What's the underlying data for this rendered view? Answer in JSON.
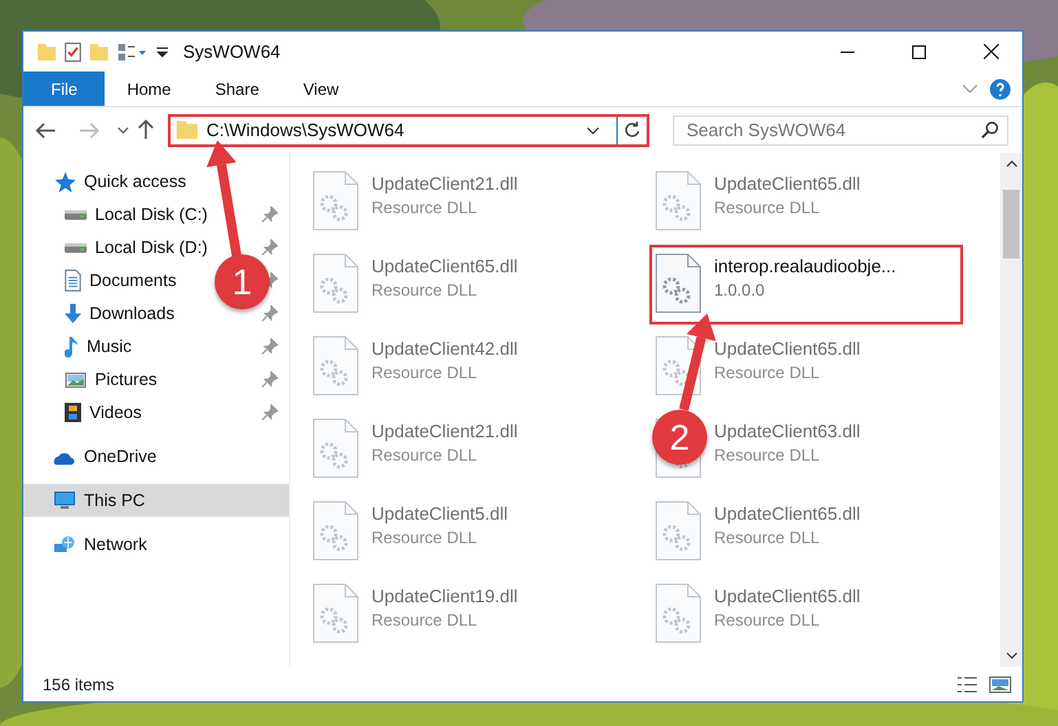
{
  "window": {
    "title": "SysWOW64"
  },
  "ribbon_tabs": [
    {
      "label": "File",
      "kind": "file"
    },
    {
      "label": "Home",
      "kind": "tab"
    },
    {
      "label": "Share",
      "kind": "tab"
    },
    {
      "label": "View",
      "kind": "tab"
    }
  ],
  "address": {
    "path": "C:\\Windows\\SysWOW64",
    "highlighted": true
  },
  "search": {
    "placeholder": "Search SysWOW64"
  },
  "sidebar": [
    {
      "label": "Quick access",
      "selected": false,
      "children": [
        {
          "label": "Local Disk (C:)",
          "pinned": true
        },
        {
          "label": "Local Disk (D:)",
          "pinned": true
        },
        {
          "label": "Documents",
          "pinned": true
        },
        {
          "label": "Downloads",
          "pinned": true
        },
        {
          "label": "Music",
          "pinned": true
        },
        {
          "label": "Pictures",
          "pinned": true
        },
        {
          "label": "Videos",
          "pinned": true
        }
      ]
    },
    {
      "label": "OneDrive",
      "selected": false
    },
    {
      "label": "This PC",
      "selected": true
    },
    {
      "label": "Network",
      "selected": false
    }
  ],
  "files": [
    {
      "name": "UpdateClient21.dll",
      "detail": "Resource DLL",
      "blurred": true,
      "highlighted": false
    },
    {
      "name": "UpdateClient65.dll",
      "detail": "Resource DLL",
      "blurred": true,
      "highlighted": false
    },
    {
      "name": "UpdateClient65.dll",
      "detail": "Resource DLL",
      "blurred": true,
      "highlighted": false
    },
    {
      "name": "interop.realaudioobje...",
      "detail": "1.0.0.0",
      "blurred": false,
      "highlighted": true
    },
    {
      "name": "UpdateClient42.dll",
      "detail": "Resource DLL",
      "blurred": true,
      "highlighted": false
    },
    {
      "name": "UpdateClient65.dll",
      "detail": "Resource DLL",
      "blurred": true,
      "highlighted": false
    },
    {
      "name": "UpdateClient21.dll",
      "detail": "Resource DLL",
      "blurred": true,
      "highlighted": false
    },
    {
      "name": "UpdateClient63.dll",
      "detail": "Resource DLL",
      "blurred": true,
      "highlighted": false
    },
    {
      "name": "UpdateClient5.dll",
      "detail": "Resource DLL",
      "blurred": true,
      "highlighted": false
    },
    {
      "name": "UpdateClient65.dll",
      "detail": "Resource DLL",
      "blurred": true,
      "highlighted": false
    },
    {
      "name": "UpdateClient19.dll",
      "detail": "Resource DLL",
      "blurred": true,
      "highlighted": false
    },
    {
      "name": "UpdateClient65.dll",
      "detail": "Resource DLL",
      "blurred": true,
      "highlighted": false
    }
  ],
  "status_bar": {
    "count": "156 items"
  },
  "annotations": [
    {
      "label": "1"
    },
    {
      "label": "2"
    }
  ]
}
